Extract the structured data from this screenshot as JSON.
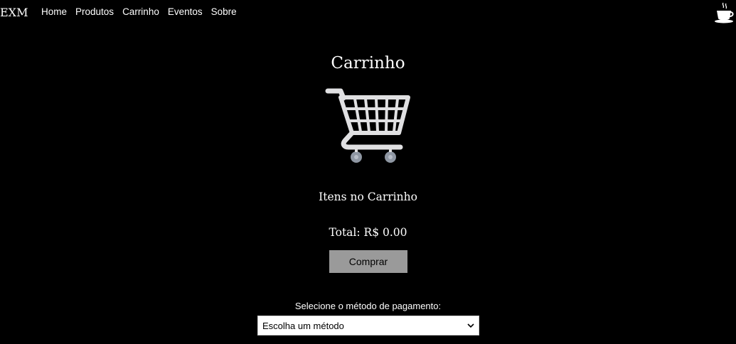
{
  "nav": {
    "brand": "EXM",
    "links": [
      "Home",
      "Produtos",
      "Carrinho",
      "Eventos",
      "Sobre"
    ],
    "cup_icon": "coffee-cup-icon"
  },
  "cart": {
    "title": "Carrinho",
    "cart_icon": "shopping-cart-icon",
    "items_heading": "Itens no Carrinho",
    "total_label": "Total: R$ 0.00",
    "buy_label": "Comprar"
  },
  "payment": {
    "label": "Selecione o método de pagamento:",
    "selected": "Escolha um método"
  },
  "colors": {
    "background": "#000000",
    "text": "#ffffff",
    "button": "#9a9a9a"
  }
}
